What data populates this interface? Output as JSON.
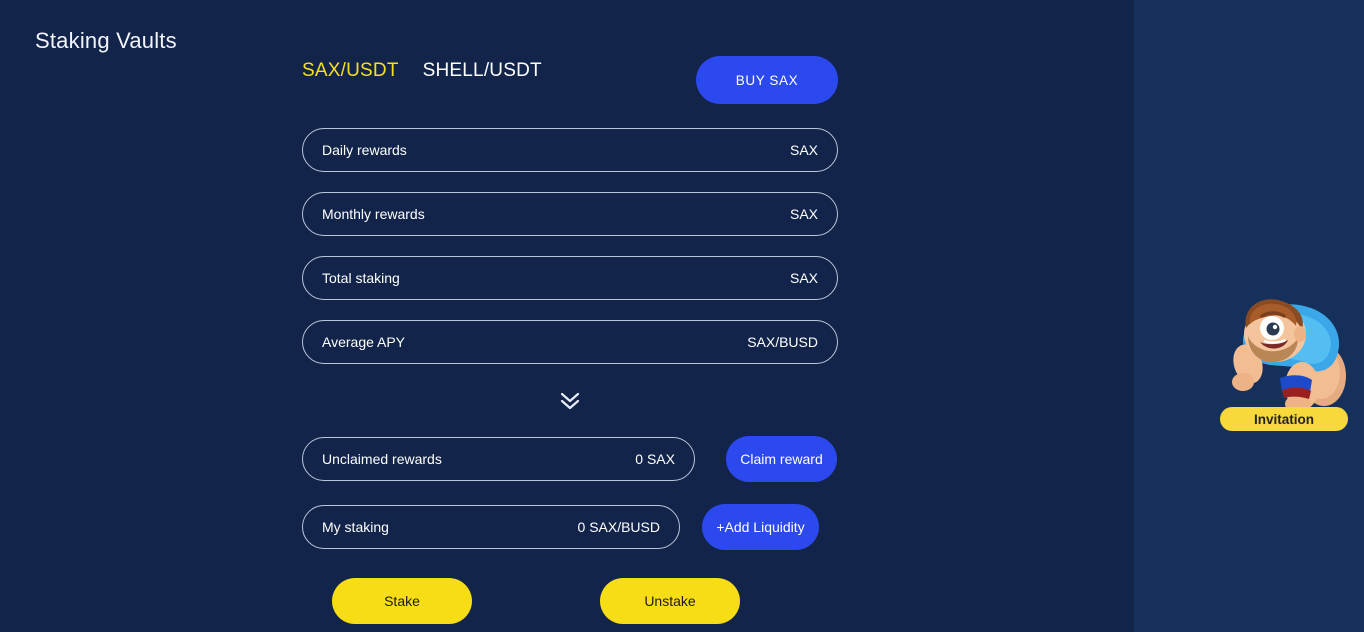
{
  "page": {
    "title": "Staking Vaults",
    "background_color": "#16305c",
    "panel_color": "#12244a",
    "accent_blue": "#2b49ee",
    "accent_yellow": "#f7dd15"
  },
  "tabs": [
    {
      "label": "SAX/USDT",
      "active": true
    },
    {
      "label": "SHELL/USDT",
      "active": false
    }
  ],
  "buy_button": {
    "label": "BUY SAX"
  },
  "info_rows": [
    {
      "label": "Daily rewards",
      "value": "SAX"
    },
    {
      "label": "Monthly rewards",
      "value": "SAX"
    },
    {
      "label": "Total staking",
      "value": "SAX"
    },
    {
      "label": "Average APY",
      "value": "SAX/BUSD"
    }
  ],
  "expand_toggle": {
    "icon": "chevron-double-down-icon"
  },
  "claim_row": {
    "label": "Unclaimed rewards",
    "value": "0 SAX",
    "button_label": "Claim reward"
  },
  "staking_row": {
    "label": "My staking",
    "value": "0 SAX/BUSD",
    "button_label": "+Add Liquidity"
  },
  "stake_actions": {
    "stake_label": "Stake",
    "unstake_label": "Unstake"
  },
  "invitation": {
    "badge_label": "Invitation",
    "icon": "mascot-character-icon"
  }
}
